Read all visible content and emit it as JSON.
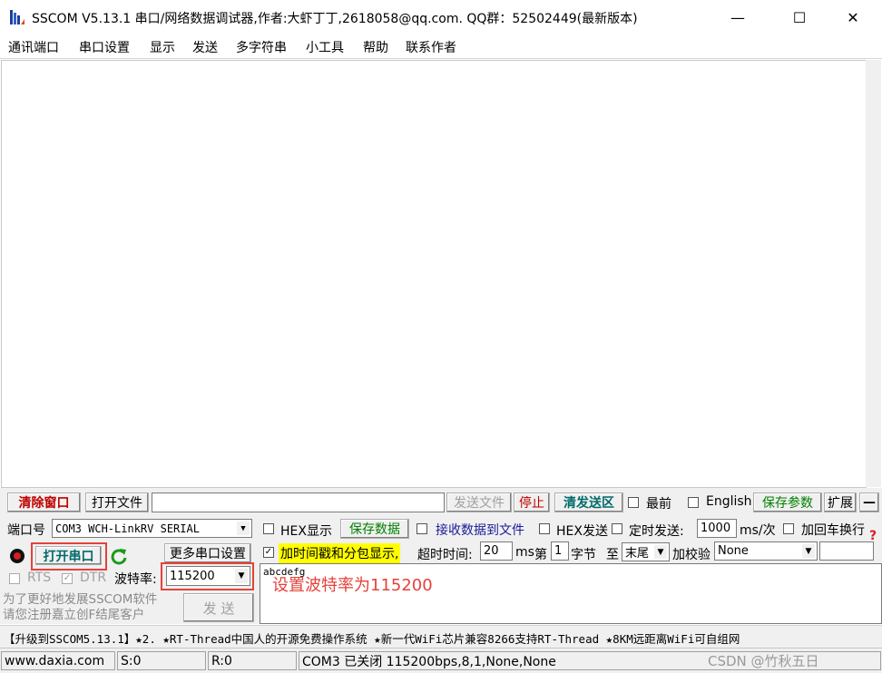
{
  "window": {
    "title": "SSCOM V5.13.1 串口/网络数据调试器,作者:大虾丁丁,2618058@qq.com. QQ群：52502449(最新版本)",
    "minimize_glyph": "—",
    "maximize_glyph": "☐",
    "close_glyph": "✕"
  },
  "menu": {
    "items": [
      "通讯端口",
      "串口设置",
      "显示",
      "发送",
      "多字符串",
      "小工具",
      "帮助",
      "联系作者"
    ]
  },
  "toolbar_row": {
    "clear_window": "清除窗口",
    "open_file": "打开文件",
    "file_path": "",
    "send_file": "发送文件",
    "stop": "停止",
    "clear_send_area": "清发送区",
    "topmost_label": "最前",
    "english_label": "English",
    "save_params": "保存参数",
    "expand": "扩展",
    "collapse": "—"
  },
  "port": {
    "port_label": "端口号",
    "port_value": "COM3  WCH-LinkRV SERIAL",
    "open_port": "打开串口",
    "more_settings": "更多串口设置",
    "rts_label": "RTS",
    "dtr_label": "DTR",
    "baud_label": "波特率:",
    "baud_value": "115200"
  },
  "options": {
    "hex_display": "HEX显示",
    "save_data": "保存数据",
    "recv_to_file": "接收数据到文件",
    "hex_send": "HEX发送",
    "timed_send": "定时发送:",
    "interval_value": "1000",
    "interval_unit": "ms/次",
    "append_crlf": "加回车换行",
    "timestamp": "加时间戳和分包显示,",
    "timeout_label": "超时时间:",
    "timeout_value": "20",
    "ms": "ms",
    "byte_prefix": "第",
    "byte_index": "1",
    "byte_suffix": "字节",
    "to_label": "至",
    "to_value": "末尾",
    "checksum_label": "加校验",
    "checksum_value": "None"
  },
  "send_text": "abcdefg",
  "annotation": "设置波特率为115200",
  "promo": "为了更好地发展SSCOM软件\n请您注册嘉立创F结尾客户",
  "send_button": "发  送",
  "ticker": "【升级到SSCOM5.13.1】★2. ★RT-Thread中国人的开源免费操作系统 ★新一代WiFi芯片兼容8266支持RT-Thread ★8KM远距离WiFi可自组网",
  "status": {
    "site": "www.daxia.com",
    "sent": "S:0",
    "recv": "R:0",
    "port_state": "COM3 已关闭  115200bps,8,1,None,None",
    "watermark": "CSDN @竹秋五日"
  }
}
